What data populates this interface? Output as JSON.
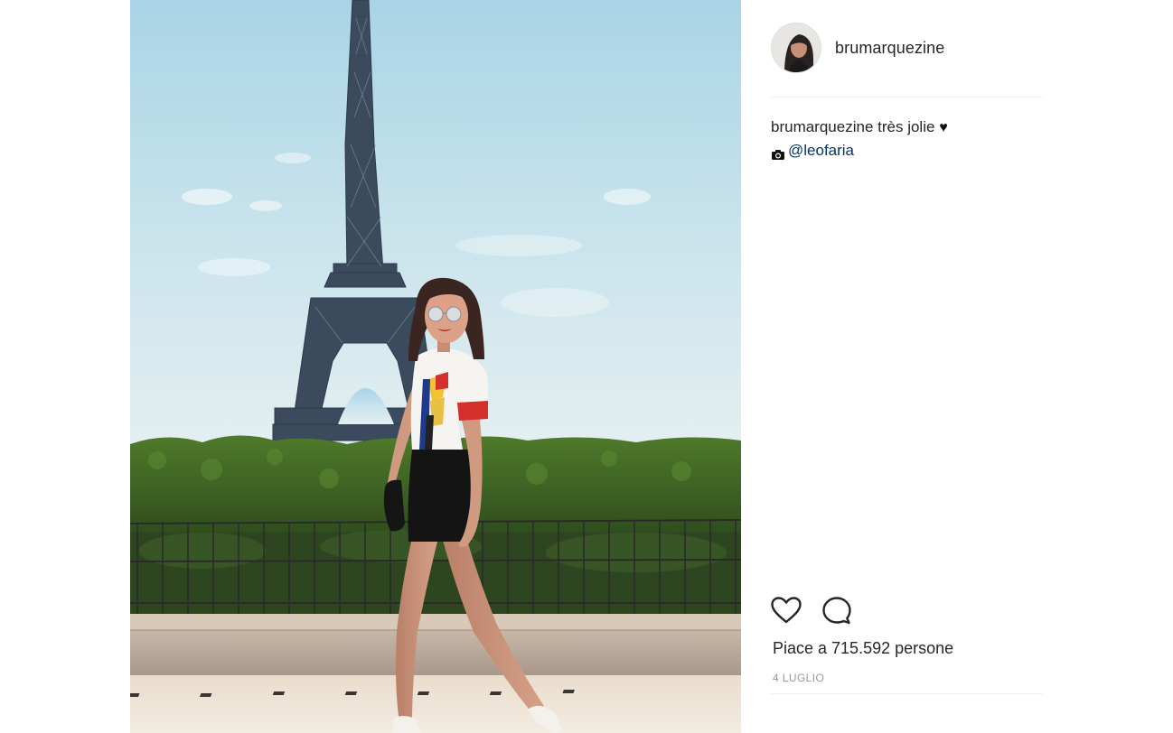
{
  "post": {
    "username": "brumarquezine",
    "caption": {
      "author": "brumarquezine",
      "text": "très jolie",
      "heart": "♥",
      "mention": "@leofaria"
    },
    "likes_text": "Piace a 715.592 persone",
    "date": "4 LUGLIO"
  },
  "icons": {
    "like": "heart-outline-icon",
    "comment": "comment-bubble-icon",
    "camera": "camera-icon"
  },
  "colors": {
    "link": "#003569",
    "text": "#262626",
    "muted": "#999999",
    "divider": "#efefef"
  }
}
